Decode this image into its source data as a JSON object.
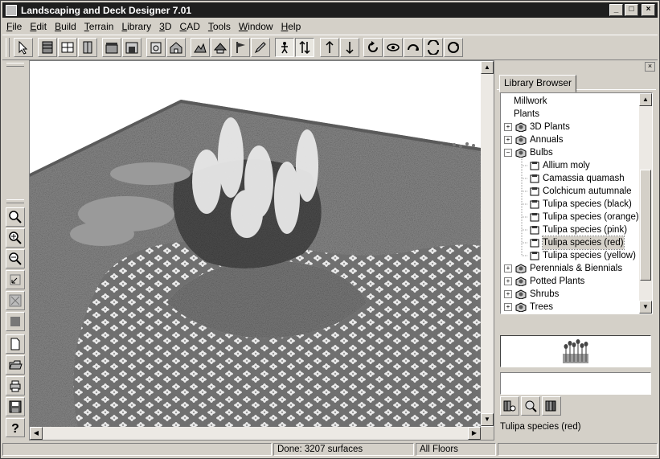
{
  "window": {
    "title": "Landscaping and Deck Designer 7.01",
    "controls": {
      "minimize": "_",
      "restore": "□",
      "close": "×"
    }
  },
  "menu": [
    {
      "label": "File",
      "key": "F"
    },
    {
      "label": "Edit",
      "key": "E"
    },
    {
      "label": "Build",
      "key": "B"
    },
    {
      "label": "Terrain",
      "key": "T"
    },
    {
      "label": "Library",
      "key": "L"
    },
    {
      "label": "3D",
      "key": "3"
    },
    {
      "label": "CAD",
      "key": "C"
    },
    {
      "label": "Tools",
      "key": "T"
    },
    {
      "label": "Window",
      "key": "W"
    },
    {
      "label": "Help",
      "key": "H"
    }
  ],
  "toolbar": {
    "buttons": [
      "select-arrow-icon",
      "wall-icon",
      "window-icon",
      "door-icon",
      "cabinet-icon",
      "fireplace-icon",
      "appliance-icon",
      "house-icon",
      "terrain-icon",
      "roof-icon",
      "flag-icon",
      "pencil-icon",
      "walkthrough-icon",
      "elevation-arrows-icon",
      "up-arrow-icon",
      "down-arrow-icon",
      "rotate-left-icon",
      "orbit-icon",
      "orbit-back-icon",
      "pan-icon",
      "refresh-icon"
    ],
    "pressed": [
      "walkthrough-icon",
      "elevation-arrows-icon"
    ]
  },
  "left_toolbar": {
    "buttons": [
      "zoom-icon",
      "zoom-in-icon",
      "zoom-out-icon",
      "undo-zoom-icon",
      "fill-window-icon",
      "stop-icon",
      "new-page-icon",
      "open-folder-icon",
      "print-icon",
      "save-icon",
      "help-icon"
    ]
  },
  "library_browser": {
    "tab_label": "Library Browser",
    "close": "×",
    "tree": [
      {
        "label": "Millwork",
        "level": 0,
        "expander": "",
        "icon": "none"
      },
      {
        "label": "Plants",
        "level": 0,
        "expander": "",
        "icon": "none"
      },
      {
        "label": "3D Plants",
        "level": 1,
        "expander": "+",
        "icon": "plant-folder-icon"
      },
      {
        "label": "Annuals",
        "level": 1,
        "expander": "+",
        "icon": "plant-folder-icon"
      },
      {
        "label": "Bulbs",
        "level": 1,
        "expander": "-",
        "icon": "plant-folder-icon"
      },
      {
        "label": "Allium moly",
        "level": 2,
        "expander": "",
        "icon": "plant-item-icon"
      },
      {
        "label": "Camassia quamash",
        "level": 2,
        "expander": "",
        "icon": "plant-item-icon"
      },
      {
        "label": "Colchicum autumnale",
        "level": 2,
        "expander": "",
        "icon": "plant-item-icon"
      },
      {
        "label": "Tulipa species (black)",
        "level": 2,
        "expander": "",
        "icon": "plant-item-icon"
      },
      {
        "label": "Tulipa species (orange)",
        "level": 2,
        "expander": "",
        "icon": "plant-item-icon"
      },
      {
        "label": "Tulipa species (pink)",
        "level": 2,
        "expander": "",
        "icon": "plant-item-icon"
      },
      {
        "label": "Tulipa species (red)",
        "level": 2,
        "expander": "",
        "icon": "plant-item-icon",
        "selected": true
      },
      {
        "label": "Tulipa species (yellow)",
        "level": 2,
        "expander": "",
        "icon": "plant-item-icon"
      },
      {
        "label": "Perennials & Biennials",
        "level": 1,
        "expander": "+",
        "icon": "plant-folder-icon"
      },
      {
        "label": "Potted Plants",
        "level": 1,
        "expander": "+",
        "icon": "plant-folder-icon"
      },
      {
        "label": "Shrubs",
        "level": 1,
        "expander": "+",
        "icon": "plant-folder-icon"
      },
      {
        "label": "Trees",
        "level": 1,
        "expander": "+",
        "icon": "plant-folder-icon"
      }
    ],
    "tools": [
      "library-search-icon",
      "find-icon",
      "add-library-icon"
    ],
    "selected_name": "Tulipa species (red)"
  },
  "status": {
    "message": "Done:  3207 surfaces",
    "floor": "All Floors"
  }
}
